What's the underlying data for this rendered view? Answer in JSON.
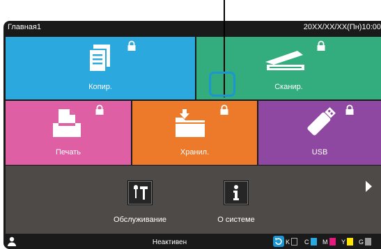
{
  "statusbar": {
    "title": "Главная1",
    "datetime": "20XX/XX/XX(Пн)10:00"
  },
  "tiles": {
    "copy": {
      "label": "Копир."
    },
    "scan": {
      "label": "Сканир."
    },
    "print": {
      "label": "Печать"
    },
    "storage": {
      "label": "Хранил."
    },
    "usb": {
      "label": "USB"
    }
  },
  "tools": {
    "maintenance": {
      "label": "Обслуживание"
    },
    "system": {
      "label": "О системе"
    }
  },
  "bottombar": {
    "status": "Неактивен",
    "inks": [
      {
        "letter": "K",
        "color": "#2b2b2b"
      },
      {
        "letter": "C",
        "color": "#27a9e1"
      },
      {
        "letter": "M",
        "color": "#e6197e"
      },
      {
        "letter": "Y",
        "color": "#ffe600"
      },
      {
        "letter": "G",
        "color": "#9a9a9a"
      }
    ]
  },
  "colors": {
    "copy": "#2ba8de",
    "scan": "#33ad7e",
    "print": "#de5fa3",
    "storage": "#ec7a2a",
    "usb": "#8f48a1",
    "highlight": "#1b96d2"
  }
}
